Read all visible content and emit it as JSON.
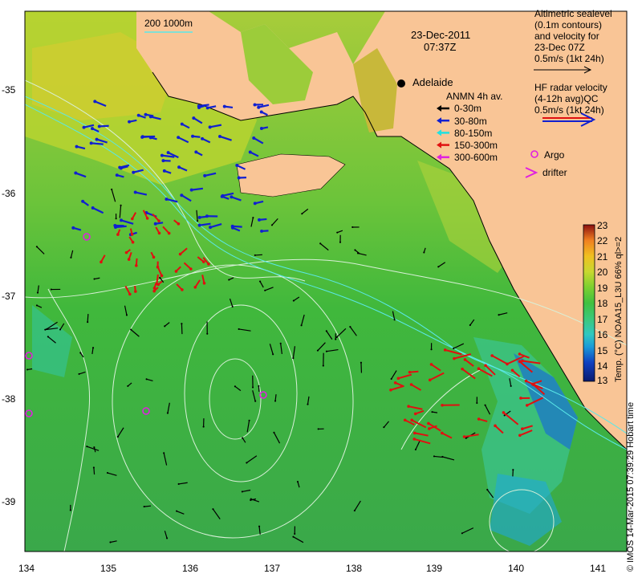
{
  "date": "23-Dec-2011",
  "time": "07:37Z",
  "scale_label": "200  1000m",
  "city": "Adelaide",
  "altimetry_legend": [
    "Altimetric sealevel",
    "(0.1m contours)",
    "and velocity for",
    "23-Dec 07Z",
    "0.5m/s (1kt 24h)"
  ],
  "hf_radar_legend": [
    "HF radar velocity",
    "(4-12h avg)",
    "0.5m/s (1kt 24h)"
  ],
  "hf_radar_suffix": "QC",
  "anmn": {
    "title": "ANMN 4h av.",
    "items": [
      {
        "label": "0-30m",
        "color": "#000000"
      },
      {
        "label": "30-80m",
        "color": "#1020d0"
      },
      {
        "label": "80-150m",
        "color": "#20e0e0"
      },
      {
        "label": "150-300m",
        "color": "#e01010"
      },
      {
        "label": "300-600m",
        "color": "#e020e0"
      }
    ]
  },
  "argo_label": "Argo",
  "drifter_label": "drifter",
  "lon_ticks": [
    "134",
    "135",
    "136",
    "137",
    "138",
    "139",
    "140",
    "141"
  ],
  "lat_ticks": [
    "-35",
    "-36",
    "-37",
    "-38",
    "-39"
  ],
  "colorbar": {
    "ticks": [
      "23",
      "22",
      "21",
      "20",
      "19",
      "18",
      "17",
      "16",
      "15",
      "14",
      "13"
    ],
    "min": 13,
    "max": 23,
    "label": "Temp. (°C) NOAA15_L3U 66% ql>=2",
    "colors": [
      "#0a1a6e",
      "#1040c0",
      "#1a9ad8",
      "#30c8c0",
      "#3cc87a",
      "#40c040",
      "#7cd030",
      "#c8d830",
      "#f0c020",
      "#f08020",
      "#d84018",
      "#8c1010"
    ]
  },
  "credit": "© IMOS 14-Mar-2015 07:39:29 Hobart time",
  "colors": {
    "land": "#f9c596",
    "sea_mid": "#38c03c",
    "sea_warm": "#b6d234",
    "contour": "#d8f0d8"
  }
}
